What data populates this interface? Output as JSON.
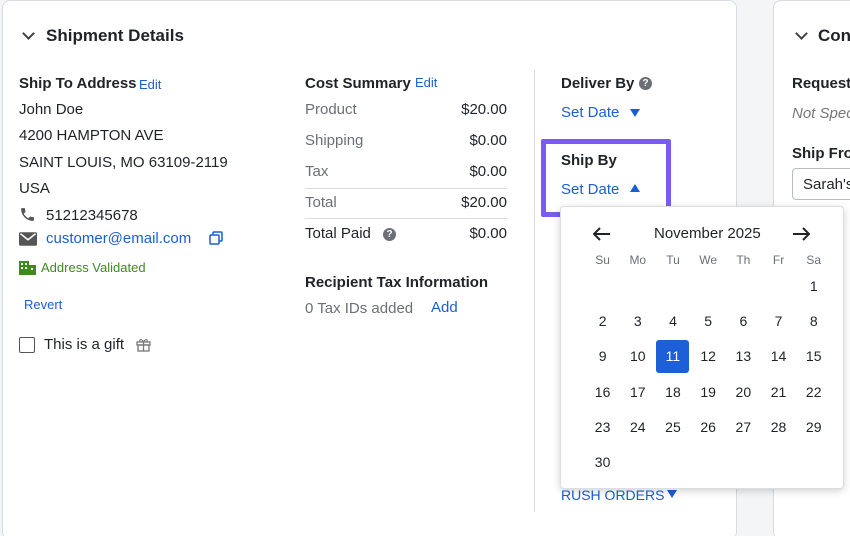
{
  "shipment": {
    "title": "Shipment Details",
    "ship_to": {
      "label": "Ship To Address",
      "edit": "Edit",
      "name": "John Doe",
      "street": "4200 HAMPTON AVE",
      "city": "SAINT LOUIS, MO 63109-2119",
      "country": "USA",
      "phone": "51212345678",
      "email": "customer@email.com",
      "validated": "Address Validated",
      "revert": "Revert",
      "gift": "This is a gift"
    },
    "cost": {
      "label": "Cost Summary",
      "edit": "Edit",
      "rows": [
        {
          "name": "Product",
          "value": "$20.00"
        },
        {
          "name": "Shipping",
          "value": "$0.00"
        },
        {
          "name": "Tax",
          "value": "$0.00"
        },
        {
          "name": "Total",
          "value": "$20.00"
        },
        {
          "name": "Total Paid",
          "value": "$0.00"
        }
      ]
    },
    "recipient_tax": {
      "label": "Recipient Tax Information",
      "count": "0 Tax IDs added",
      "add": "Add"
    },
    "deliver_by": {
      "label": "Deliver By",
      "action": "Set Date"
    },
    "ship_by": {
      "label": "Ship By",
      "action": "Set Date"
    },
    "rush": "RUSH ORDERS"
  },
  "calendar": {
    "month": "November 2025",
    "weekdays": [
      "Su",
      "Mo",
      "Tu",
      "We",
      "Th",
      "Fr",
      "Sa"
    ],
    "selected": "11",
    "days": [
      "",
      "",
      "",
      "",
      "",
      "",
      "1",
      "2",
      "3",
      "4",
      "5",
      "6",
      "7",
      "8",
      "9",
      "10",
      "11",
      "12",
      "13",
      "14",
      "15",
      "16",
      "17",
      "18",
      "19",
      "20",
      "21",
      "22",
      "23",
      "24",
      "25",
      "26",
      "27",
      "28",
      "29",
      "30"
    ]
  },
  "right_panel": {
    "title": "Con",
    "requested": "Requeste",
    "not_specified": "Not Spec",
    "ship_from": "Ship Fron",
    "ship_from_value": "Sarah's"
  }
}
